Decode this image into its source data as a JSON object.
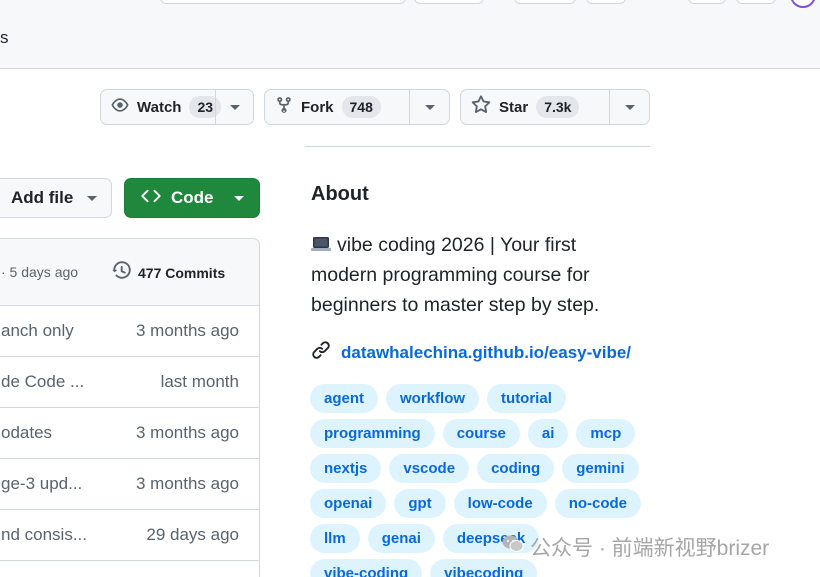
{
  "header": {
    "nav_fragment": "s"
  },
  "actions": {
    "watch": {
      "label": "Watch",
      "count": "23"
    },
    "fork": {
      "label": "Fork",
      "count": "748"
    },
    "star": {
      "label": "Star",
      "count": "7.3k"
    }
  },
  "toolbar": {
    "add_file_label": "Add file",
    "code_label": "Code"
  },
  "files": {
    "last_commit_ago": "· 5 days ago",
    "commits_label": "477 Commits",
    "rows": [
      {
        "message": "anch only",
        "age": "3 months ago"
      },
      {
        "message": "de Code ...",
        "age": "last month"
      },
      {
        "message": "odates",
        "age": "3 months ago"
      },
      {
        "message": "ge-3 upd...",
        "age": "3 months ago"
      },
      {
        "message": "nd consis...",
        "age": "29 days ago"
      }
    ]
  },
  "about": {
    "title": "About",
    "description": "vibe coding 2026 | Your first modern programming course for beginners to master step by step.",
    "link": "datawhalechina.github.io/easy-vibe/",
    "topics": [
      [
        "agent",
        "workflow",
        "tutorial"
      ],
      [
        "programming",
        "course",
        "ai",
        "mcp"
      ],
      [
        "nextjs",
        "vscode",
        "coding",
        "gemini"
      ],
      [
        "openai",
        "gpt",
        "low-code",
        "no-code"
      ],
      [
        "llm",
        "genai",
        "deepseek"
      ],
      [
        "vibe-coding",
        "vibecoding"
      ]
    ]
  },
  "watermark": {
    "text": "公众号 · 前端新视野brizer"
  },
  "colors": {
    "accent_green": "#1f883d",
    "link_blue": "#0969da",
    "topic_bg": "#ddf4ff"
  }
}
